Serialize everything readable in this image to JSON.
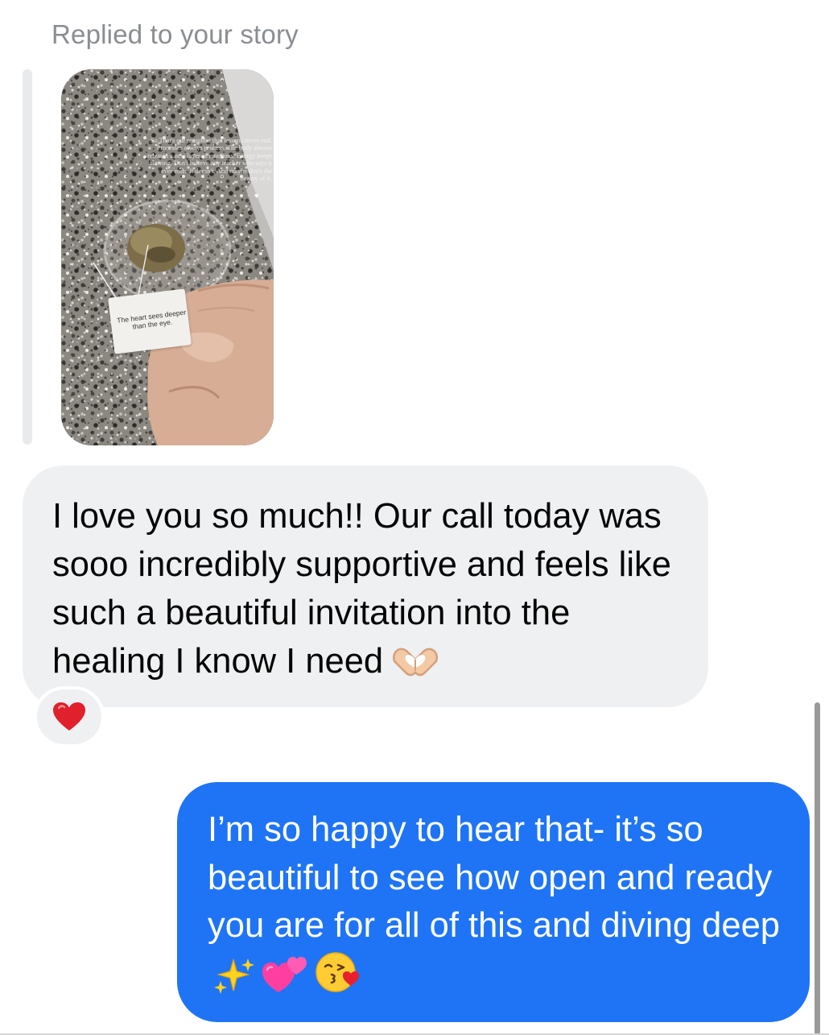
{
  "thread": {
    "reply_header": "Replied to your story",
    "story": {
      "overlay_text": "So That's our reminder that lessons never end. Processes always process. The body always releases a new layer of emotions. Energy keeps flowing. Don't believe any teacher who says it ever ends. It doesn't. And maybe that's the beauty of it.",
      "tag_text": "The heart sees deeper than the eye."
    },
    "incoming_message": {
      "text": "I love you so much!! Our call today was sooo incredibly supportive and feels like such a beautiful invitation into the healing I know I need",
      "emoji": "heart-hands-icon",
      "reaction": "red-heart-icon"
    },
    "outgoing_message": {
      "text": "I’m so happy to hear that- it’s so beautiful to see how open and ready you are for all of this and diving deep",
      "emojis": [
        "sparkles-icon",
        "two-hearts-icon",
        "face-blowing-kiss-icon"
      ]
    }
  },
  "colors": {
    "outgoing_bubble": "#1f74f5",
    "incoming_bubble": "#eff0f2",
    "header_text": "#8a8d91",
    "reply_bar": "#e9eaec"
  }
}
